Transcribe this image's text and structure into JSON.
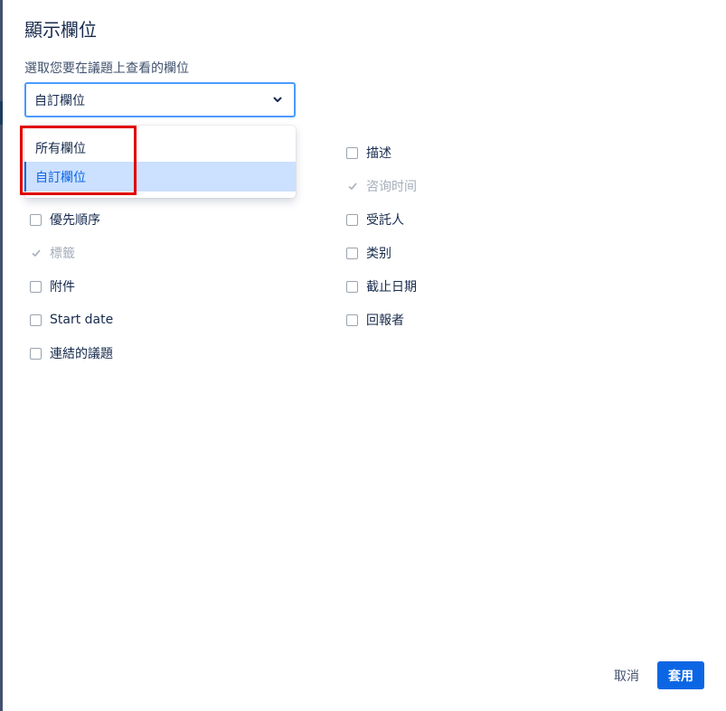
{
  "dialog": {
    "title": "顯示欄位",
    "field_label": "選取您要在議題上查看的欄位"
  },
  "select": {
    "value": "自訂欄位",
    "options": [
      "所有欄位",
      "自訂欄位"
    ],
    "selected_index": 1
  },
  "fields_left": [
    {
      "label": "優先順序",
      "checked": false,
      "disabled": false
    },
    {
      "label": "標籤",
      "checked": true,
      "disabled": true
    },
    {
      "label": "附件",
      "checked": false,
      "disabled": false
    },
    {
      "label": "Start date",
      "checked": false,
      "disabled": false
    },
    {
      "label": "連結的議題",
      "checked": false,
      "disabled": false
    }
  ],
  "fields_right": [
    {
      "label": "描述",
      "checked": false,
      "disabled": false
    },
    {
      "label": "咨询时间",
      "checked": true,
      "disabled": true
    },
    {
      "label": "受託人",
      "checked": false,
      "disabled": false
    },
    {
      "label": "类别",
      "checked": false,
      "disabled": false
    },
    {
      "label": "截止日期",
      "checked": false,
      "disabled": false
    },
    {
      "label": "回報者",
      "checked": false,
      "disabled": false
    }
  ],
  "footer": {
    "cancel_label": "取消",
    "apply_label": "套用"
  },
  "colors": {
    "primary": "#0c66e4",
    "focus_border": "#4c9aff",
    "selected_option_bg": "#cce0ff",
    "annotation_box": "#e00000"
  },
  "icons": {
    "select_chevron": "chevron-down-icon",
    "checkbox_checked": "check-icon"
  }
}
